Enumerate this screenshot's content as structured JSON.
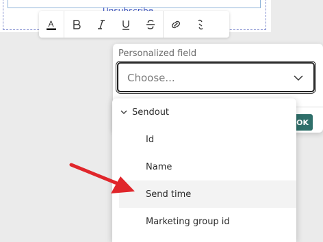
{
  "canvas": {
    "partial_text": "Unsubscribe"
  },
  "toolbar": {
    "buttons": [
      "text-color",
      "bold",
      "italic",
      "underline",
      "strikethrough",
      "link",
      "unlink"
    ],
    "text_color_letter": "A",
    "bold_letter": "B",
    "italic_letter": "I",
    "underline_letter": "U",
    "strike_letter": "S"
  },
  "field_panel": {
    "label": "Personalized field",
    "select_placeholder": "Choose...",
    "ok_label": "OK"
  },
  "dropdown": {
    "group_label": "Sendout",
    "items": [
      "Id",
      "Name",
      "Send time",
      "Marketing group id"
    ],
    "hovered_item": "Send time"
  },
  "colors": {
    "ok_button": "#2f6f6a",
    "annotation_arrow": "#e0262b",
    "hover_row": "#f3f3f3"
  }
}
